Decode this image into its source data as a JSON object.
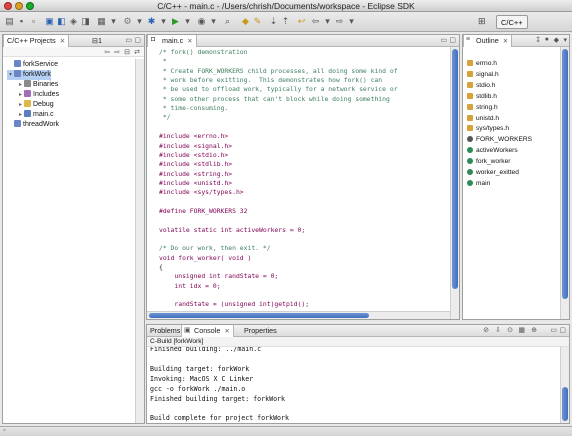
{
  "window": {
    "title": "C/C++ - main.c - /Users/chrish/Documents/workspace - Eclipse SDK"
  },
  "toolbar": {
    "perspective_label": "C/C++"
  },
  "projects_view": {
    "tab_label": "C/C++ Projects",
    "items": [
      {
        "label": "forkService",
        "expander": "",
        "icon": "project-folder-icon"
      },
      {
        "label": "forkWork",
        "expander": "▾",
        "icon": "project-folder-icon"
      },
      {
        "label": "Binaries",
        "expander": "▸",
        "icon": "binaries-icon"
      },
      {
        "label": "Includes",
        "expander": "▸",
        "icon": "includes-icon"
      },
      {
        "label": "Debug",
        "expander": "▸",
        "icon": "folder-icon"
      },
      {
        "label": "main.c",
        "expander": "▸",
        "icon": "c-file-icon"
      },
      {
        "label": "threadWork",
        "expander": "",
        "icon": "project-folder-icon"
      }
    ]
  },
  "editor": {
    "tab_label": "main.c",
    "lines": [
      {
        "text": "/* fork() demonstration",
        "style": "comment"
      },
      {
        "text": " *",
        "style": "comment"
      },
      {
        "text": " * Create FORK_WORKERS child processes, all doing some kind of",
        "style": "comment"
      },
      {
        "text": " * work before exitting.  This demonstrates how fork() can",
        "style": "comment"
      },
      {
        "text": " * be used to offload work, typically for a network service or",
        "style": "comment"
      },
      {
        "text": " * some other process that can't block while doing something",
        "style": "comment"
      },
      {
        "text": " * time-consuming.",
        "style": "comment"
      },
      {
        "text": " */",
        "style": "comment"
      },
      {
        "text": "",
        "style": "plain"
      },
      {
        "text": "#include <errno.h>",
        "style": "inc"
      },
      {
        "text": "#include <signal.h>",
        "style": "inc"
      },
      {
        "text": "#include <stdio.h>",
        "style": "inc"
      },
      {
        "text": "#include <stdlib.h>",
        "style": "inc"
      },
      {
        "text": "#include <string.h>",
        "style": "inc"
      },
      {
        "text": "#include <unistd.h>",
        "style": "inc"
      },
      {
        "text": "#include <sys/types.h>",
        "style": "inc"
      },
      {
        "text": "",
        "style": "plain"
      },
      {
        "text": "#define FORK_WORKERS 32",
        "style": "inc"
      },
      {
        "text": "",
        "style": "plain"
      },
      {
        "text": "volatile static int activeWorkers = 0;",
        "style": "kw"
      },
      {
        "text": "",
        "style": "plain"
      },
      {
        "text": "/* Do our work, then exit. */",
        "style": "comment"
      },
      {
        "text": "void fork_worker( void )",
        "style": "kw"
      },
      {
        "text": "{",
        "style": "plain"
      },
      {
        "text": "    unsigned int randState = 0;",
        "style": "kw"
      },
      {
        "text": "    int idx = 0;",
        "style": "kw"
      },
      {
        "text": "",
        "style": "plain"
      },
      {
        "text": "    randState = (unsigned int)getpid();",
        "style": "kw"
      }
    ]
  },
  "outline": {
    "tab_label": "Outline",
    "items": [
      {
        "label": "errno.h",
        "kind": "include"
      },
      {
        "label": "signal.h",
        "kind": "include"
      },
      {
        "label": "stdio.h",
        "kind": "include"
      },
      {
        "label": "stdlib.h",
        "kind": "include"
      },
      {
        "label": "string.h",
        "kind": "include"
      },
      {
        "label": "unistd.h",
        "kind": "include"
      },
      {
        "label": "sys/types.h",
        "kind": "include"
      },
      {
        "label": "FORK_WORKERS",
        "kind": "macro"
      },
      {
        "label": "activeWorkers",
        "kind": "variable"
      },
      {
        "label": "fork_worker",
        "kind": "function"
      },
      {
        "label": "worker_exitted",
        "kind": "function"
      },
      {
        "label": "main",
        "kind": "function"
      }
    ]
  },
  "bottom_panel": {
    "tabs": [
      "Problems",
      "Console",
      "Properties"
    ],
    "active_tab": "Console",
    "console_header": "C-Build [forkWork]",
    "lines": [
      "Finished building: ../main.c",
      "",
      "Building target: forkWork",
      "Invoking: MacOS X C Linker",
      "gcc -o forkWork ./main.o",
      "Finished building target: forkWork",
      "",
      "Build complete for project forkWork"
    ]
  },
  "colors": {
    "selection": "#b5cff2",
    "comment": "#3f7f5f",
    "keyword": "#7f0055",
    "scroll_thumb": "#3f6fc0"
  }
}
